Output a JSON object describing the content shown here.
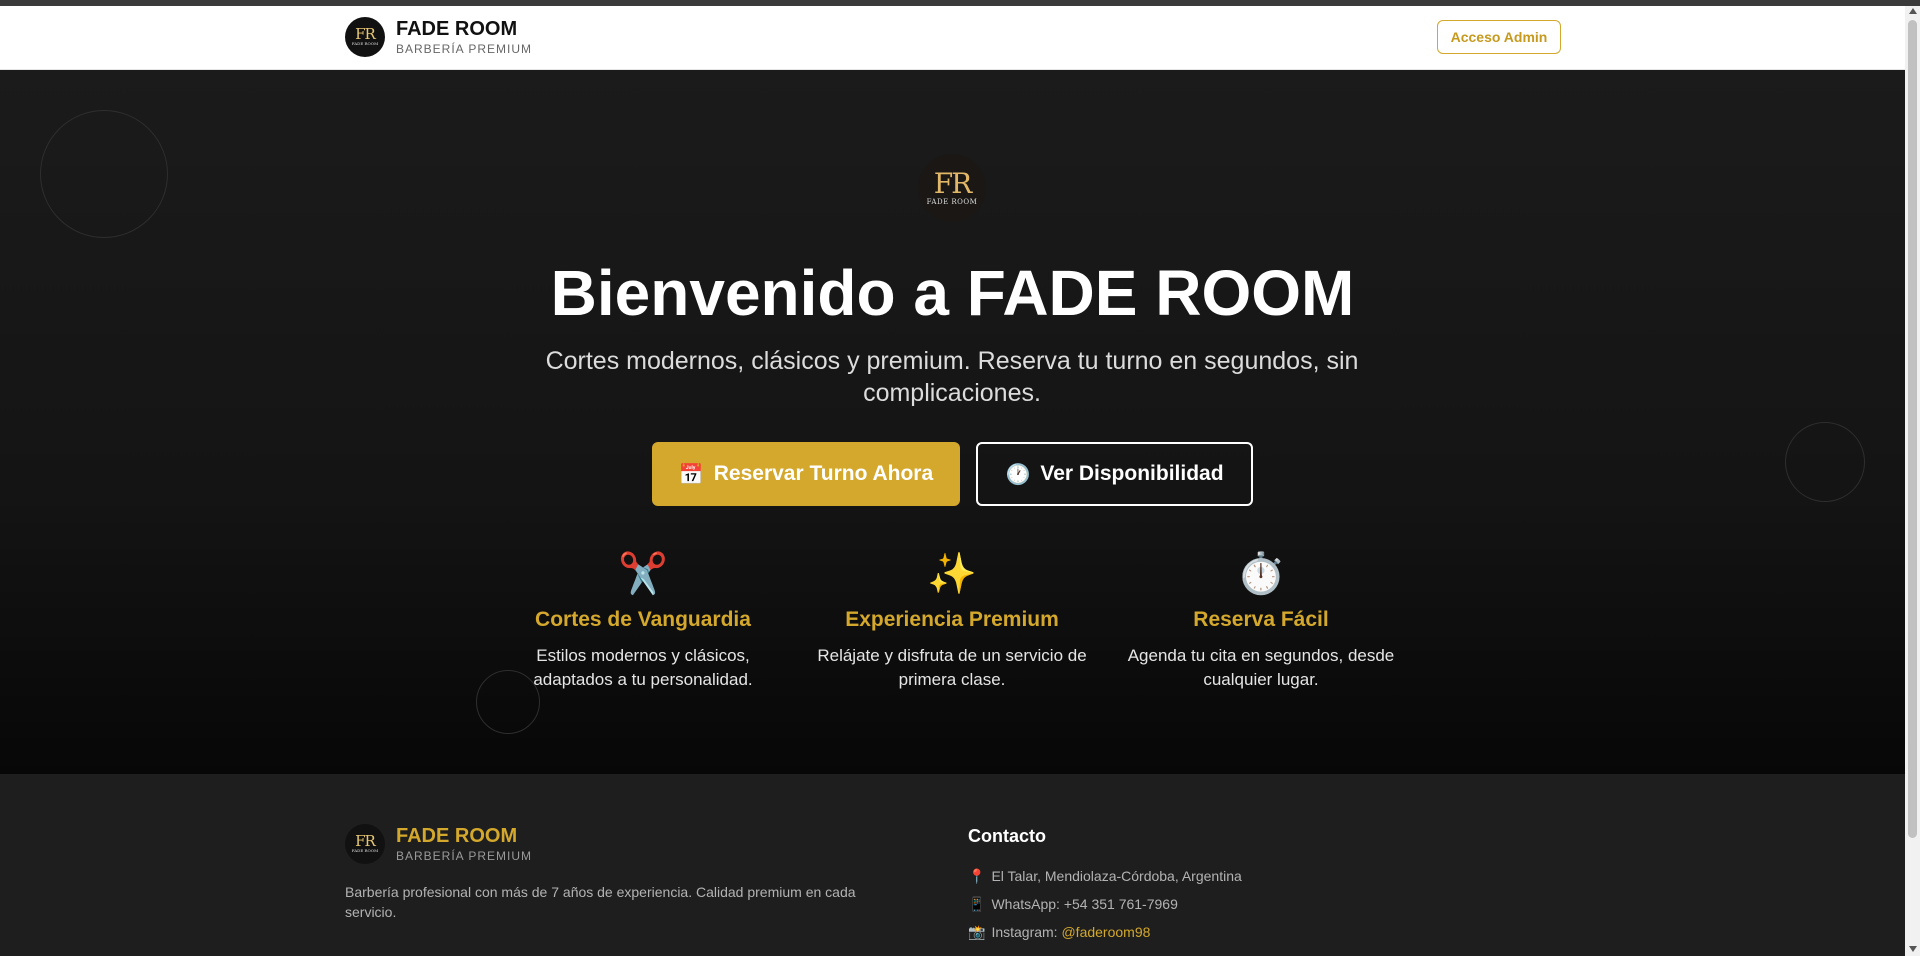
{
  "header": {
    "logo_initials": "FR",
    "logo_subtext": "FADE ROOM",
    "brand_name": "FADE ROOM",
    "brand_tagline": "BARBERÍA PREMIUM",
    "admin_button": "Acceso Admin"
  },
  "hero": {
    "logo_initials": "FR",
    "logo_subtext": "FADE ROOM",
    "title": "Bienvenido a FADE ROOM",
    "subtitle": "Cortes modernos, clásicos y premium. Reserva tu turno en segundos, sin complicaciones.",
    "primary_cta": {
      "icon": "📅",
      "icon_name": "calendar-icon",
      "label": "Reservar Turno Ahora"
    },
    "secondary_cta": {
      "icon": "🕐",
      "icon_name": "clock-icon",
      "label": "Ver Disponibilidad"
    },
    "features": [
      {
        "icon": "✂️",
        "icon_name": "scissors-icon",
        "title": "Cortes de Vanguardia",
        "description": "Estilos modernos y clásicos, adaptados a tu personalidad."
      },
      {
        "icon": "✨",
        "icon_name": "sparkles-icon",
        "title": "Experiencia Premium",
        "description": "Relájate y disfruta de un servicio de primera clase."
      },
      {
        "icon": "⏱️",
        "icon_name": "stopwatch-icon",
        "title": "Reserva Fácil",
        "description": "Agenda tu cita en segundos, desde cualquier lugar."
      }
    ]
  },
  "footer": {
    "logo_initials": "FR",
    "logo_subtext": "FADE ROOM",
    "brand_name": "FADE ROOM",
    "brand_tagline": "BARBERÍA PREMIUM",
    "description": "Barbería profesional con más de 7 años de experiencia. Calidad premium en cada servicio.",
    "contact_title": "Contacto",
    "contact": {
      "address_icon": "📍",
      "address": "El Talar, Mendiolaza-Córdoba, Argentina",
      "whatsapp_icon": "📱",
      "whatsapp_label": "WhatsApp: ",
      "whatsapp": "+54 351 761-7969",
      "instagram_icon": "📸",
      "instagram_label": "Instagram: ",
      "instagram": "@faderoom98"
    }
  },
  "colors": {
    "accent": "#d4a82c",
    "hero_bg": "#141414",
    "footer_bg": "#1e1e1e"
  }
}
